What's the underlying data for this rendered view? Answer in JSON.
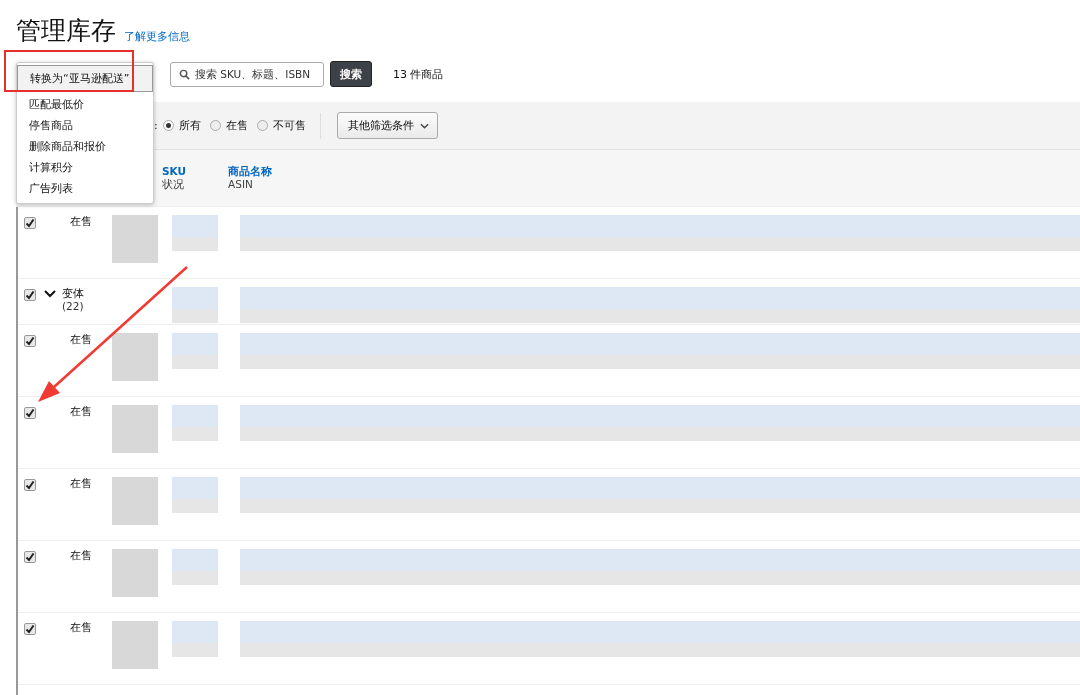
{
  "page_title": "管理库存",
  "help_link": "了解更多信息",
  "action_menu": {
    "items": [
      {
        "label": "转换为“亚马逊配送”",
        "selected": true
      },
      {
        "label": "匹配最低价",
        "selected": false
      },
      {
        "label": "停售商品",
        "selected": false
      },
      {
        "label": "删除商品和报价",
        "selected": false
      },
      {
        "label": "计算积分",
        "selected": false
      },
      {
        "label": "广告列表",
        "selected": false
      }
    ]
  },
  "search": {
    "placeholder": "搜索 SKU、标题、ISBN",
    "button": "搜索"
  },
  "result_count": "13 件商品",
  "filters": {
    "label": ":",
    "options": [
      {
        "label": "所有",
        "selected": true
      },
      {
        "label": "在售",
        "selected": false
      },
      {
        "label": "不可售",
        "selected": false
      }
    ],
    "more_button": "其他筛选条件"
  },
  "table": {
    "columns": [
      {
        "title": "SKU",
        "subtitle": "状况"
      },
      {
        "title": "商品名称",
        "subtitle": "ASIN"
      }
    ],
    "rows": [
      {
        "kind": "product",
        "checked": true,
        "status": "在售"
      },
      {
        "kind": "variant",
        "checked": true,
        "expanded": true,
        "status": "变体",
        "count": "(22)"
      },
      {
        "kind": "product",
        "checked": true,
        "status": "在售"
      },
      {
        "kind": "product",
        "checked": true,
        "status": "在售"
      },
      {
        "kind": "product",
        "checked": true,
        "status": "在售"
      },
      {
        "kind": "product",
        "checked": true,
        "status": "在售"
      },
      {
        "kind": "product",
        "checked": true,
        "status": "在售"
      }
    ]
  }
}
